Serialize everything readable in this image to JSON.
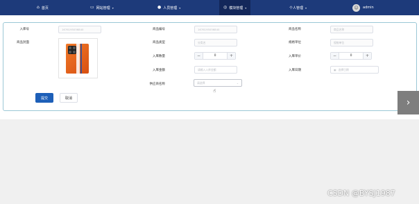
{
  "nav": {
    "home": {
      "icon": "⌂",
      "label": "首页"
    },
    "site": {
      "icon": "▭",
      "label": "网站管理"
    },
    "personnel": {
      "icon": "●",
      "label": "人员管理"
    },
    "inventory": {
      "icon": "◎",
      "label": "模块管理"
    },
    "profile": {
      "label": "个人管理"
    },
    "user": {
      "avatar": "☺",
      "name": "admin"
    }
  },
  "form": {
    "inbound_no": {
      "label": "入库号",
      "value": "1676195056840"
    },
    "product_code": {
      "label": "商品编号",
      "value": "1676195056840"
    },
    "product_name": {
      "label": "商品名称",
      "placeholder": "商品名称"
    },
    "product_image": {
      "label": "商品封面"
    },
    "product_type": {
      "label": "商品类型",
      "placeholder": "分类名"
    },
    "spec_unit": {
      "label": "规格单位",
      "placeholder": "规格单位"
    },
    "inbound_qty": {
      "label": "入库数量",
      "value": "0",
      "minus": "−",
      "plus": "+"
    },
    "inbound_price": {
      "label": "入库单价",
      "value": "0",
      "minus": "−",
      "plus": "+"
    },
    "inbound_amount": {
      "label": "入库金额",
      "placeholder": "请输入入库金额"
    },
    "inbound_date": {
      "label": "入库日期",
      "icon": "▣",
      "placeholder": "选择日期"
    },
    "supplier": {
      "label": "供应商名称",
      "placeholder": "请选择",
      "chevron": "⌄"
    }
  },
  "actions": {
    "submit": "提交",
    "cancel": "取消"
  },
  "carousel": {
    "next": "›"
  },
  "watermark": "CSDN @BYSJ1987"
}
